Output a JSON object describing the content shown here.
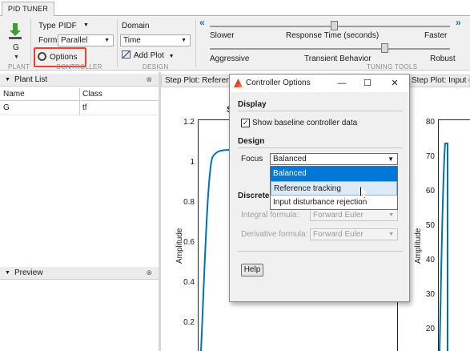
{
  "app": {
    "tab_label": "PID TUNER"
  },
  "ribbon": {
    "plant": {
      "value": "G",
      "section": "PLANT"
    },
    "controller": {
      "type_label": "Type",
      "type_value": "PIDF",
      "form_label": "Form",
      "form_value": "Parallel",
      "options_label": "Options",
      "section": "CONTROLLER"
    },
    "design": {
      "domain_label": "Domain",
      "domain_value": "Time",
      "add_plot_label": "Add Plot",
      "section": "DESIGN"
    },
    "tuning": {
      "response_time": {
        "left": "Slower",
        "center": "Response Time (seconds)",
        "right": "Faster",
        "level": 0.52
      },
      "transient": {
        "left": "Aggressive",
        "center": "Transient Behavior",
        "right": "Robust",
        "level": 0.73
      },
      "section": "TUNING TOOLS"
    }
  },
  "plant_list": {
    "title": "Plant List",
    "columns": [
      "Name",
      "Class"
    ],
    "rows": [
      {
        "name": "G",
        "class": "tf"
      }
    ]
  },
  "preview": {
    "title": "Preview"
  },
  "plots": [
    {
      "tab": "Step Plot: Reference tracking",
      "title": "S",
      "ylabel": "Amplitude",
      "yticks": [
        "1.2",
        "1",
        "0.8",
        "0.6",
        "0.4",
        "0.2"
      ]
    },
    {
      "tab": "Step Plot: Input disturbance rejection",
      "ylabel": "Amplitude",
      "yticks": [
        "80",
        "70",
        "60",
        "50",
        "40",
        "30",
        "20"
      ]
    }
  ],
  "dialog": {
    "title": "Controller Options",
    "display_heading": "Display",
    "show_baseline_label": "Show baseline controller data",
    "show_baseline_checked": true,
    "design_heading": "Design",
    "focus_label": "Focus",
    "focus_value": "Balanced",
    "focus_options": [
      "Balanced",
      "Reference tracking",
      "Input disturbance rejection"
    ],
    "discrete_heading": "Discrete",
    "integral_label": "Integral formula:",
    "integral_value": "Forward Euler",
    "derivative_label": "Derivative formula:",
    "derivative_value": "Forward Euler",
    "help_label": "Help"
  },
  "colors": {
    "accent": "#0078d7",
    "highlight": "#e8412f",
    "curve": "#0072bd"
  }
}
